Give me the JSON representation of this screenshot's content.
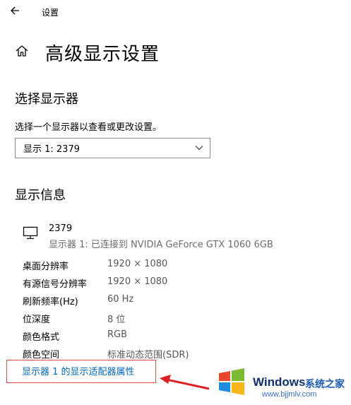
{
  "window": {
    "title": "设置"
  },
  "page": {
    "title": "高级显示设置"
  },
  "select_display": {
    "heading": "选择显示器",
    "description": "选择一个显示器以查看或更改设置。",
    "dropdown_value": "显示 1: 2379"
  },
  "display_info": {
    "heading": "显示信息",
    "monitor_name": "2379",
    "monitor_desc": "显示器 1: 已连接到 NVIDIA GeForce GTX 1060 6GB",
    "rows": [
      {
        "label": "桌面分辨率",
        "value": "1920 × 1080"
      },
      {
        "label": "有源信号分辨率",
        "value": "1920 × 1080"
      },
      {
        "label": "刷新频率(Hz)",
        "value": "60 Hz"
      },
      {
        "label": "位深度",
        "value": "8 位"
      },
      {
        "label": "颜色格式",
        "value": "RGB"
      },
      {
        "label": "颜色空间",
        "value": "标准动态范围(SDR)"
      }
    ],
    "adapter_link": "显示器 1 的显示适配器属性"
  },
  "watermark": {
    "brand": "Windows",
    "brand_cn": "系统之家",
    "url": "www.bjjmlv.com"
  },
  "colors": {
    "link": "#0067c0",
    "highlight": "#e04646"
  }
}
